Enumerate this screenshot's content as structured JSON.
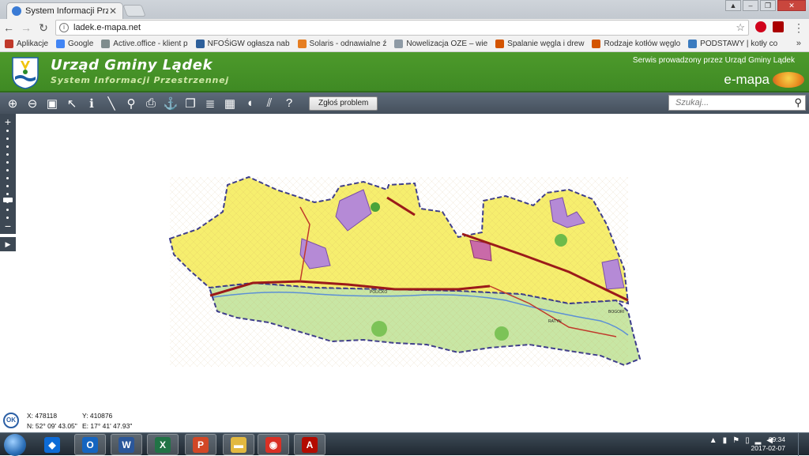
{
  "browser": {
    "tab_title": "System Informacji Przestrzennej",
    "url": "ladek.e-mapa.net",
    "bookmarks": [
      {
        "label": "Aplikacje",
        "color": "#c0392b"
      },
      {
        "label": "Google",
        "color": "#4285f4"
      },
      {
        "label": "Active.office - klient p",
        "color": "#7f8c8d"
      },
      {
        "label": "NFOŚiGW ogłasza nab",
        "color": "#2d5f9a"
      },
      {
        "label": "Solaris - odnawialne ź",
        "color": "#e67e22"
      },
      {
        "label": "Nowelizacja OZE – wie",
        "color": "#8e9aa5"
      },
      {
        "label": "Spalanie węgla i drew",
        "color": "#d35400"
      },
      {
        "label": "Rodzaje kotłów węglo",
        "color": "#d35400"
      },
      {
        "label": "PODSTAWY | kotły co",
        "color": "#3b7bbf"
      }
    ],
    "more": "»"
  },
  "header": {
    "title": "Urząd Gminy Lądek",
    "subtitle": "System Informacji Przestrzennej",
    "provider": "Serwis prowadzony przez Urząd Gminy Lądek",
    "brand": "e-mapa"
  },
  "toolbar": {
    "tools": [
      {
        "name": "zoom-in-icon",
        "glyph": "⊕"
      },
      {
        "name": "zoom-out-icon",
        "glyph": "⊖"
      },
      {
        "name": "full-extent-icon",
        "glyph": "▣"
      },
      {
        "name": "pointer-icon",
        "glyph": "↖"
      },
      {
        "name": "info-icon",
        "glyph": "ℹ"
      },
      {
        "name": "measure-icon",
        "glyph": "╲"
      },
      {
        "name": "link-icon",
        "glyph": "⚲"
      },
      {
        "name": "print-icon",
        "glyph": "⎙"
      },
      {
        "name": "pin-icon",
        "glyph": "⚓"
      },
      {
        "name": "copy-icon",
        "glyph": "❐"
      },
      {
        "name": "layers-icon",
        "glyph": "≣"
      },
      {
        "name": "layout-icon",
        "glyph": "▦"
      },
      {
        "name": "comment-icon",
        "glyph": "◖"
      },
      {
        "name": "hatch-icon",
        "glyph": "⫽"
      },
      {
        "name": "help-icon",
        "glyph": "?"
      }
    ],
    "report_label": "Zgłoś problem",
    "search_placeholder": "Szukaj..."
  },
  "map_labels": {
    "place1": "POLICKO",
    "place2": "RATYN",
    "place3": "BOGORI"
  },
  "coords": {
    "ok": "OK",
    "x": "X: 478118",
    "y": "Y: 410876",
    "n": "N: 52° 09' 43.05\"",
    "e": "E: 17° 41' 47.93\""
  },
  "taskbar": {
    "apps": [
      {
        "name": "dropbox",
        "glyph": "◆",
        "color": "#0d6bd6"
      },
      {
        "name": "outlook",
        "glyph": "O",
        "color": "#1565c0"
      },
      {
        "name": "word",
        "glyph": "W",
        "color": "#2b579a"
      },
      {
        "name": "excel",
        "glyph": "X",
        "color": "#217346"
      },
      {
        "name": "powerpoint",
        "glyph": "P",
        "color": "#d24726"
      },
      {
        "name": "explorer",
        "glyph": "▬",
        "color": "#e2b840"
      },
      {
        "name": "chrome",
        "glyph": "◉",
        "color": "#d93025"
      },
      {
        "name": "acrobat",
        "glyph": "A",
        "color": "#b30b00"
      }
    ],
    "time": "09:34",
    "date": "2017-02-07"
  }
}
